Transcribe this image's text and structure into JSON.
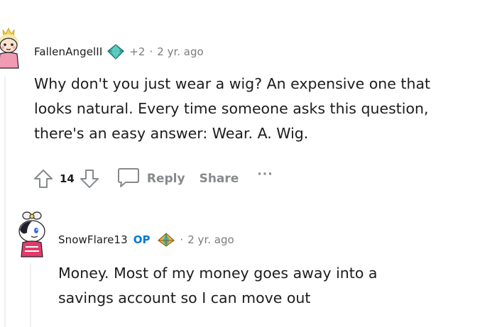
{
  "comments": [
    {
      "username": "FallenAngelII",
      "flair_icon": "diamond-gem-icon",
      "points": "+2",
      "separator": "·",
      "age": "2 yr. ago",
      "body_lines": [
        "Why don't you just wear a wig? An expensive one that",
        "looks natural. Every time someone asks this question,",
        "there's an easy answer: Wear. A. Wig."
      ],
      "score": "14",
      "reply_label": "Reply",
      "share_label": "Share",
      "more_label": "···"
    },
    {
      "username": "SnowFlare13",
      "op_label": "OP",
      "flair_icon": "gem-pyramid-icon",
      "separator": "·",
      "age": "2 yr. ago",
      "body_lines": [
        "Money. Most of my money goes away into a",
        "savings account so I can move out"
      ]
    }
  ],
  "colors": {
    "text": "#1c1c1c",
    "meta": "#787c7e",
    "action": "#878a8c",
    "op": "#0079d3",
    "thread_line": "#edeff1"
  }
}
